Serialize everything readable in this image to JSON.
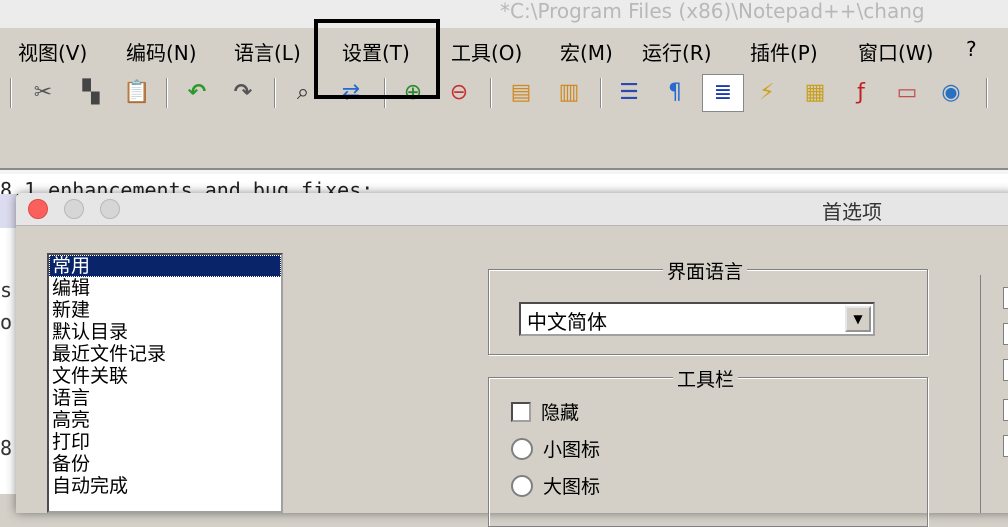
{
  "window": {
    "title": "*C:\\Program Files (x86)\\Notepad++\\chang"
  },
  "menu": [
    {
      "label": "视图(V)"
    },
    {
      "label": "编码(N)"
    },
    {
      "label": "语言(L)"
    },
    {
      "label": "设置(T)"
    },
    {
      "label": "工具(O)"
    },
    {
      "label": "宏(M)"
    },
    {
      "label": "运行(R)"
    },
    {
      "label": "插件(P)"
    },
    {
      "label": "窗口(W)"
    },
    {
      "label": "?"
    }
  ],
  "toolbar_icons": [
    "cut-icon",
    "copy-icon",
    "paste-icon",
    "undo-icon",
    "redo-icon",
    "find-icon",
    "replace-icon",
    "zoom-in-icon",
    "zoom-out-icon",
    "sync-vertical-icon",
    "sync-horizontal-icon",
    "word-wrap-icon",
    "show-all-chars-icon",
    "indent-guide-icon",
    "user-language-icon",
    "document-map-icon",
    "function-list-icon",
    "folder-workspace-icon",
    "monitoring-icon"
  ],
  "editor": {
    "line1": "8.1 enhancements and bug fixes:",
    "gutter": [
      "s",
      "o",
      "8"
    ]
  },
  "dialog": {
    "title": "首选项",
    "categories": [
      "常用",
      "编辑",
      "新建",
      "默认目录",
      "最近文件记录",
      "文件关联",
      "语言",
      "高亮",
      "打印",
      "备份",
      "自动完成"
    ],
    "selected_category": "常用",
    "ui_language": {
      "label": "界面语言",
      "value": "中文简体"
    },
    "toolbar_group": {
      "label": "工具栏",
      "options": [
        {
          "label": "隐藏",
          "type": "checkbox",
          "checked": false
        },
        {
          "label": "小图标",
          "type": "radio",
          "checked": false
        },
        {
          "label": "大图标",
          "type": "radio",
          "checked": false
        }
      ]
    }
  },
  "colors": {
    "accent_selection": "#0a246a",
    "dialog_bg": "#d4d0c8",
    "close": "#fc605c"
  }
}
